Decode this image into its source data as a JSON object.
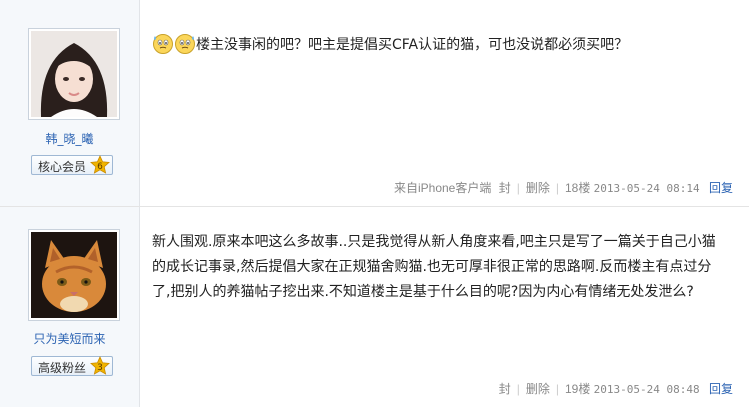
{
  "posts": [
    {
      "username": "韩_晓_曦",
      "badge": {
        "label": "核心会员",
        "level": "6"
      },
      "emoticons": [
        "sweat-face-icon",
        "sweat-face-icon"
      ],
      "content": "楼主没事闲的吧？吧主是提倡买CFA认证的猫，可也没说都必须买吧？",
      "client": "来自iPhone客户端",
      "seal": "封",
      "delete": "删除",
      "floor": "18楼",
      "timestamp": "2013-05-24 08:14",
      "reply": "回复"
    },
    {
      "username": "只为美短而来",
      "badge": {
        "label": "高级粉丝",
        "level": "3"
      },
      "content": "新人围观.原来本吧这么多故事..只是我觉得从新人角度来看,吧主只是写了一篇关于自己小猫的成长记事录,然后提倡大家在正规猫舍购猫.也无可厚非很正常的思路啊.反而楼主有点过分了,把别人的养猫帖子挖出来.不知道楼主是基于什么目的呢?因为内心有情绪无处发泄么?",
      "seal": "封",
      "delete": "删除",
      "floor": "19楼",
      "timestamp": "2013-05-24 08:48",
      "reply": "回复"
    }
  ],
  "colors": {
    "link": "#2d64b3",
    "meta": "#888888",
    "sidebar_bg": "#f5f8fb",
    "badge_star": "#f0b400"
  }
}
